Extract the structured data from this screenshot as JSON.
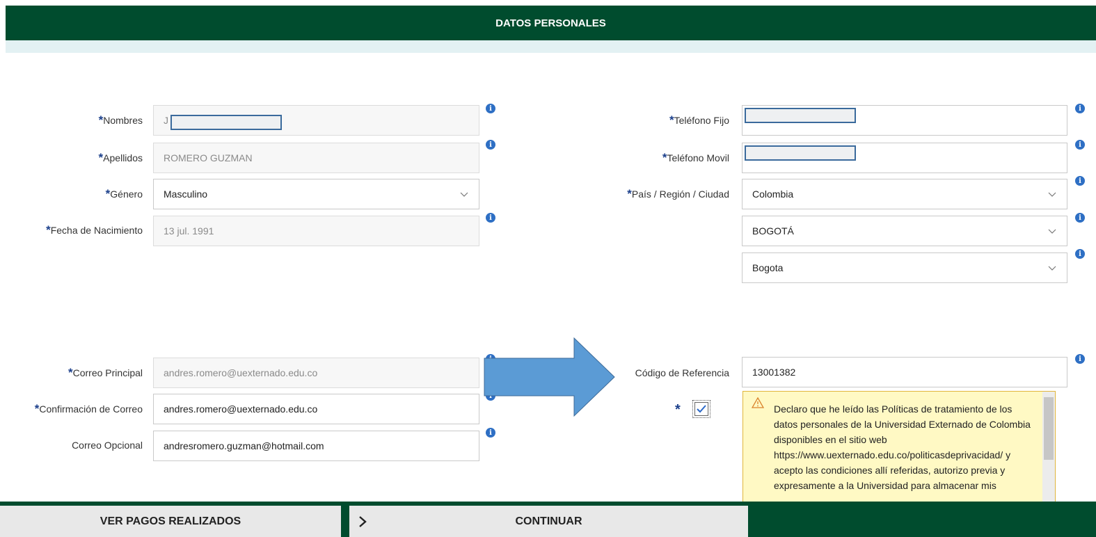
{
  "header": {
    "title": "DATOS PERSONALES"
  },
  "required_mark": "*",
  "left": {
    "nombres": {
      "label": "Nombres",
      "value": "J"
    },
    "apellidos": {
      "label": "Apellidos",
      "value": "ROMERO GUZMAN"
    },
    "genero": {
      "label": "Género",
      "value": "Masculino"
    },
    "fecha": {
      "label": "Fecha de Nacimiento",
      "value": "13 jul. 1991"
    },
    "correo_principal": {
      "label": "Correo Principal",
      "value": "andres.romero@uexternado.edu.co"
    },
    "confirmacion": {
      "label": "Confirmación de Correo",
      "value": "andres.romero@uexternado.edu.co"
    },
    "correo_opcional": {
      "label": "Correo Opcional",
      "value": "andresromero.guzman@hotmail.com"
    }
  },
  "right": {
    "telefono_fijo": {
      "label": "Teléfono Fijo",
      "value": ""
    },
    "telefono_movil": {
      "label": "Teléfono Movil",
      "value": ""
    },
    "pais": {
      "label": "País / Región / Ciudad",
      "value": "Colombia"
    },
    "region": {
      "value": "BOGOTÁ"
    },
    "ciudad": {
      "value": "Bogota"
    },
    "codigo": {
      "label": "Código de Referencia",
      "value": "13001382"
    }
  },
  "privacy": {
    "text": "Declaro que he leído las Políticas de tratamiento de los datos personales de la Universidad Externado de Colombia disponibles en el sitio web https://www.uexternado.edu.co/politicasdeprivacidad/ y acepto las condiciones allí referidas, autorizo previa y expresamente a la Universidad para almacenar mis",
    "checked": true
  },
  "footer": {
    "ver_pagos": "VER PAGOS REALIZADOS",
    "continuar": "CONTINUAR"
  },
  "colors": {
    "header": "#004c2e",
    "info": "#2e6fc4",
    "arrow": "#5b9bd5",
    "required": "#1b3f8b"
  },
  "icons": [
    "info-icon",
    "chevron-down-icon",
    "warning-icon",
    "check-icon",
    "chevron-right-icon",
    "arrow-right-icon"
  ]
}
